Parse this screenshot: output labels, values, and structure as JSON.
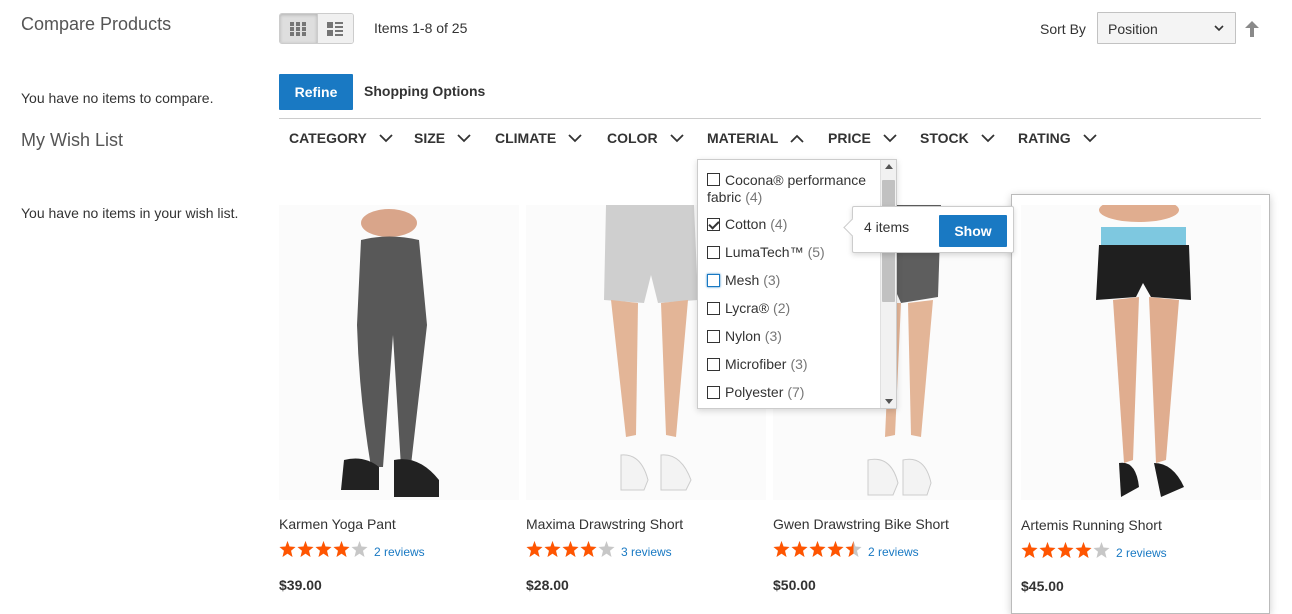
{
  "sidebar": {
    "compare_title": "Compare Products",
    "compare_empty": "You have no items to compare.",
    "wishlist_title": "My Wish List",
    "wishlist_empty": "You have no items in your wish list."
  },
  "toolbar": {
    "amount": "Items 1-8 of 25",
    "sort_label": "Sort By",
    "sort_value": "Position",
    "view_modes": [
      "grid-icon",
      "list-icon"
    ],
    "active_mode": "grid"
  },
  "refine": {
    "refine_label": "Refine",
    "options_label": "Shopping Options"
  },
  "filters": [
    {
      "label": "CATEGORY",
      "expanded": false
    },
    {
      "label": "SIZE",
      "expanded": false
    },
    {
      "label": "CLIMATE",
      "expanded": false
    },
    {
      "label": "COLOR",
      "expanded": false
    },
    {
      "label": "MATERIAL",
      "expanded": true
    },
    {
      "label": "PRICE",
      "expanded": false
    },
    {
      "label": "STOCK",
      "expanded": false
    },
    {
      "label": "RATING",
      "expanded": false
    }
  ],
  "material_options": [
    {
      "label": "Cocona® performance fabric",
      "count": "(4)",
      "checked": false
    },
    {
      "label": "Cotton",
      "count": "(4)",
      "checked": true
    },
    {
      "label": "LumaTech™",
      "count": "(5)",
      "checked": false
    },
    {
      "label": "Mesh",
      "count": "(3)",
      "checked": false
    },
    {
      "label": "Lycra®",
      "count": "(2)",
      "checked": false
    },
    {
      "label": "Nylon",
      "count": "(3)",
      "checked": false
    },
    {
      "label": "Microfiber",
      "count": "(3)",
      "checked": false
    },
    {
      "label": "Polyester",
      "count": "(7)",
      "checked": false
    }
  ],
  "show_popup": {
    "count": "4 items",
    "button": "Show"
  },
  "products": [
    {
      "name": "Karmen Yoga Pant",
      "rating": 4,
      "reviews": "2 reviews",
      "price": "$39.00"
    },
    {
      "name": "Maxima Drawstring Short",
      "rating": 4,
      "reviews": "3 reviews",
      "price": "$28.00"
    },
    {
      "name": "Gwen Drawstring Bike Short",
      "rating": 4.5,
      "reviews": "2 reviews",
      "price": "$50.00"
    },
    {
      "name": "Artemis Running Short",
      "rating": 4,
      "reviews": "2 reviews",
      "price": "$45.00"
    }
  ],
  "colors": {
    "accent": "#1979c3",
    "star": "#ff5501",
    "star_empty": "#c7c7c7"
  }
}
